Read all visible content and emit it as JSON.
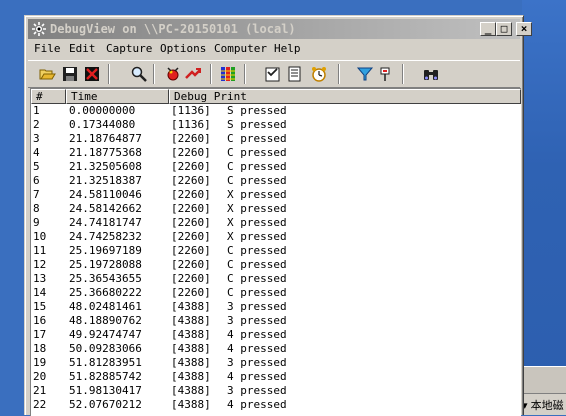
{
  "window": {
    "title": "DebugView on \\\\PC-20150101 (local)",
    "controls": {
      "minimize": "_",
      "maximize": "□",
      "close": "×"
    }
  },
  "menu": [
    "File",
    "Edit",
    "Capture",
    "Options",
    "Computer",
    "Help"
  ],
  "toolbar": {
    "icons": [
      "open-icon",
      "save-icon",
      "clear-display-icon",
      "find-icon",
      "capture-icon",
      "capture-kernel-icon",
      "autoscroll-icon",
      "clock-time-icon",
      "highlight-icon",
      "history-depth-icon",
      "filter-icon",
      "pin-icon",
      "binoculars-icon"
    ]
  },
  "table": {
    "headers": {
      "num": "#",
      "time": "Time",
      "print": "Debug Print"
    },
    "rows": [
      {
        "num": "1",
        "time": "0.00000000",
        "pid": "[1136]",
        "msg": "S pressed"
      },
      {
        "num": "2",
        "time": "0.17344080",
        "pid": "[1136]",
        "msg": "S pressed"
      },
      {
        "num": "3",
        "time": "21.18764877",
        "pid": "[2260]",
        "msg": "C pressed"
      },
      {
        "num": "4",
        "time": "21.18775368",
        "pid": "[2260]",
        "msg": "C pressed"
      },
      {
        "num": "5",
        "time": "21.32505608",
        "pid": "[2260]",
        "msg": "C pressed"
      },
      {
        "num": "6",
        "time": "21.32518387",
        "pid": "[2260]",
        "msg": "C pressed"
      },
      {
        "num": "7",
        "time": "24.58110046",
        "pid": "[2260]",
        "msg": "X pressed"
      },
      {
        "num": "8",
        "time": "24.58142662",
        "pid": "[2260]",
        "msg": "X pressed"
      },
      {
        "num": "9",
        "time": "24.74181747",
        "pid": "[2260]",
        "msg": "X pressed"
      },
      {
        "num": "10",
        "time": "24.74258232",
        "pid": "[2260]",
        "msg": "X pressed"
      },
      {
        "num": "11",
        "time": "25.19697189",
        "pid": "[2260]",
        "msg": "C pressed"
      },
      {
        "num": "12",
        "time": "25.19728088",
        "pid": "[2260]",
        "msg": "C pressed"
      },
      {
        "num": "13",
        "time": "25.36543655",
        "pid": "[2260]",
        "msg": "C pressed"
      },
      {
        "num": "14",
        "time": "25.36680222",
        "pid": "[2260]",
        "msg": "C pressed"
      },
      {
        "num": "15",
        "time": "48.02481461",
        "pid": "[4388]",
        "msg": "3 pressed"
      },
      {
        "num": "16",
        "time": "48.18890762",
        "pid": "[4388]",
        "msg": "3 pressed"
      },
      {
        "num": "17",
        "time": "49.92474747",
        "pid": "[4388]",
        "msg": "4 pressed"
      },
      {
        "num": "18",
        "time": "50.09283066",
        "pid": "[4388]",
        "msg": "4 pressed"
      },
      {
        "num": "19",
        "time": "51.81283951",
        "pid": "[4388]",
        "msg": "3 pressed"
      },
      {
        "num": "20",
        "time": "51.82885742",
        "pid": "[4388]",
        "msg": "4 pressed"
      },
      {
        "num": "21",
        "time": "51.98130417",
        "pid": "[4388]",
        "msg": "3 pressed"
      },
      {
        "num": "22",
        "time": "52.07670212",
        "pid": "[4388]",
        "msg": "4 pressed"
      }
    ]
  },
  "taskbar": {
    "tray_text": "本地磁"
  }
}
